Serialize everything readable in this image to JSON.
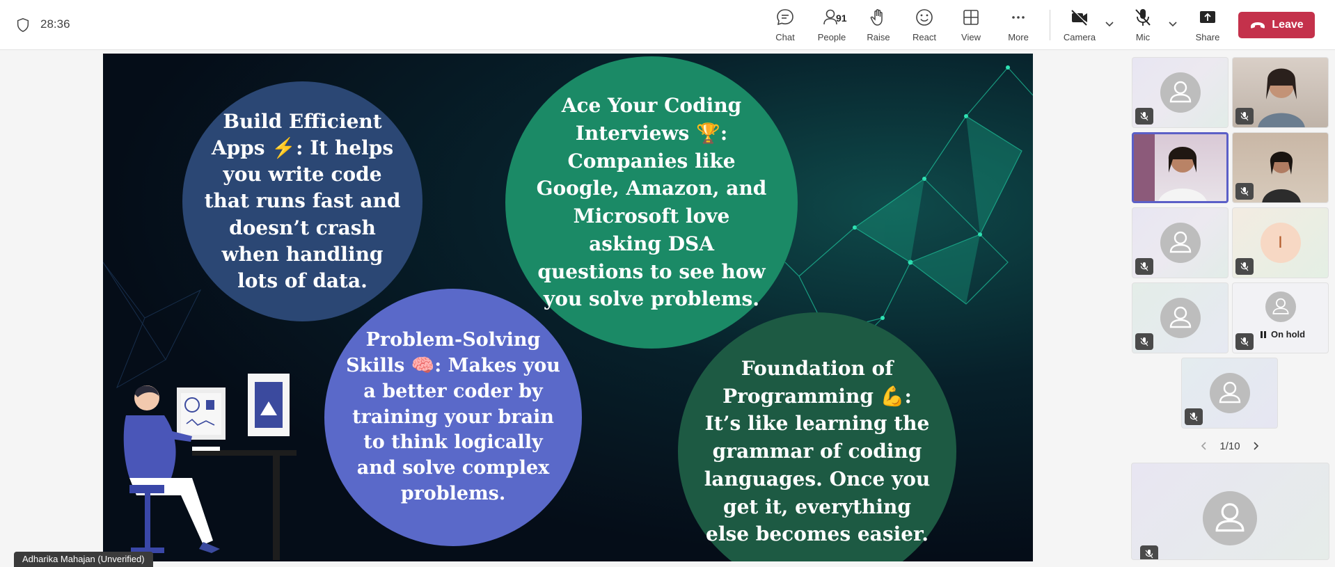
{
  "topbar": {
    "timer": "28:36",
    "people_count": "91",
    "buttons": {
      "chat": "Chat",
      "people": "People",
      "raise": "Raise",
      "react": "React",
      "view": "View",
      "more": "More",
      "camera": "Camera",
      "mic": "Mic",
      "share": "Share"
    },
    "leave": "Leave",
    "leave_color": "#c4314b"
  },
  "slide": {
    "bubble1": {
      "title": "Build Efficient Apps ⚡: It helps you write code that runs fast and doesn’t crash when handling lots of data."
    },
    "bubble2": {
      "title": "Ace Your Coding Interviews 🏆: Companies like Google, Amazon, and Microsoft love asking DSA questions to see how you solve problems."
    },
    "bubble3": {
      "title": "Problem-Solving Skills 🧠: Makes you a better coder by training your brain to think logically and solve complex problems."
    },
    "bubble4": {
      "title": "Foundation of Programming 💪: It’s like learning the grammar of coding languages. Once you get it, everything else becomes easier."
    }
  },
  "presenter_tag": "Adharika Mahajan (Unverified)",
  "participants": {
    "initial": "I",
    "on_hold": "On hold",
    "pager": "1/10"
  }
}
